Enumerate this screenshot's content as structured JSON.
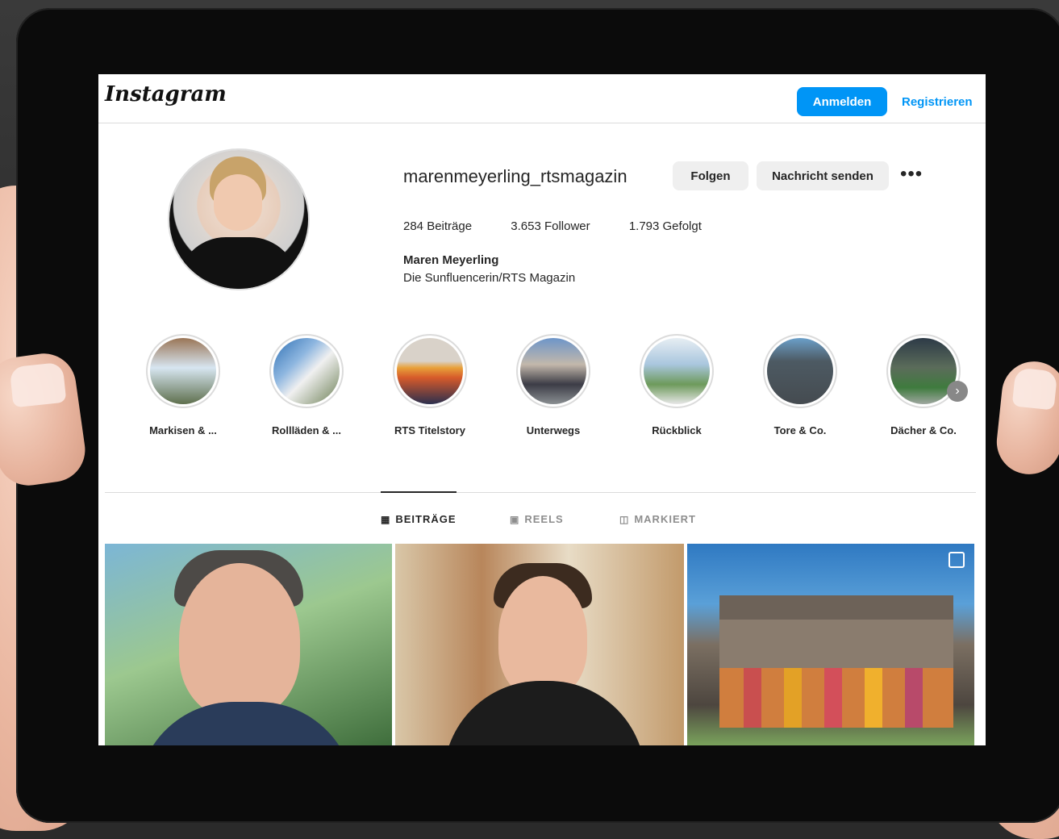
{
  "header": {
    "logo": "Instagram",
    "login_label": "Anmelden",
    "register_label": "Registrieren"
  },
  "profile": {
    "username": "marenmeyerling_rtsmagazin",
    "follow_label": "Folgen",
    "message_label": "Nachricht senden",
    "more_label": "•••",
    "stats": {
      "posts": "284 Beiträge",
      "followers": "3.653 Follower",
      "following": "1.793 Gefolgt"
    },
    "name": "Maren Meyerling",
    "bio": "Die Sunfluencerin/RTS Magazin"
  },
  "highlights": [
    {
      "label": "Markisen & ..."
    },
    {
      "label": "Rollläden & ..."
    },
    {
      "label": "RTS Titelstory"
    },
    {
      "label": "Unterwegs"
    },
    {
      "label": "Rückblick"
    },
    {
      "label": "Tore & Co."
    },
    {
      "label": "Dächer & Co."
    }
  ],
  "tabs": [
    {
      "label": "BEITRÄGE",
      "icon": "grid-icon",
      "active": true
    },
    {
      "label": "REELS",
      "icon": "reels-icon",
      "active": false
    },
    {
      "label": "MARKIERT",
      "icon": "tagged-icon",
      "active": false
    }
  ],
  "colors": {
    "accent": "#0095f6",
    "text": "#262626",
    "muted": "#8e8e8e"
  }
}
